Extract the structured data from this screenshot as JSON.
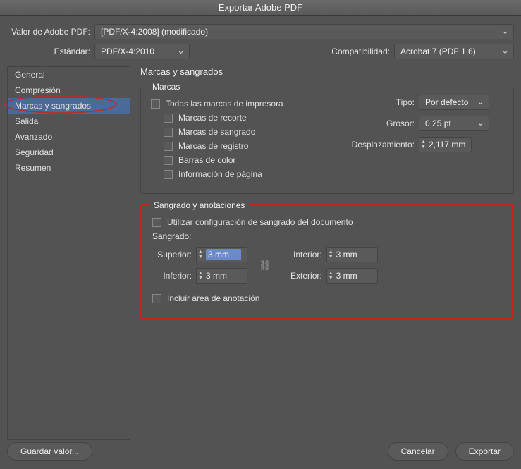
{
  "title": "Exportar Adobe PDF",
  "top": {
    "preset_label": "Valor de Adobe PDF:",
    "preset_value": "[PDF/X-4:2008] (modificado)",
    "standard_label": "Estándar:",
    "standard_value": "PDF/X-4:2010",
    "compat_label": "Compatibilidad:",
    "compat_value": "Acrobat 7 (PDF 1.6)"
  },
  "sidebar": {
    "items": [
      {
        "label": "General"
      },
      {
        "label": "Compresión"
      },
      {
        "label": "Marcas y sangrados"
      },
      {
        "label": "Salida"
      },
      {
        "label": "Avanzado"
      },
      {
        "label": "Seguridad"
      },
      {
        "label": "Resumen"
      }
    ]
  },
  "panel_title": "Marcas y sangrados",
  "marks": {
    "legend": "Marcas",
    "all": "Todas las marcas de impresora",
    "crop": "Marcas de recorte",
    "bleed": "Marcas de sangrado",
    "reg": "Marcas de registro",
    "color": "Barras de color",
    "page": "Información de página",
    "type_label": "Tipo:",
    "type_value": "Por defecto",
    "weight_label": "Grosor:",
    "weight_value": "0,25 pt",
    "offset_label": "Desplazamiento:",
    "offset_value": "2,117 mm"
  },
  "bleed": {
    "legend": "Sangrado y anotaciones",
    "use_doc": "Utilizar configuración de sangrado del documento",
    "heading": "Sangrado:",
    "top_label": "Superior:",
    "top_value": "3 mm",
    "bottom_label": "Inferior:",
    "bottom_value": "3 mm",
    "inside_label": "Interior:",
    "inside_value": "3 mm",
    "outside_label": "Exterior:",
    "outside_value": "3 mm",
    "slug": "Incluir área de anotación"
  },
  "footer": {
    "save": "Guardar valor...",
    "cancel": "Cancelar",
    "export": "Exportar"
  }
}
